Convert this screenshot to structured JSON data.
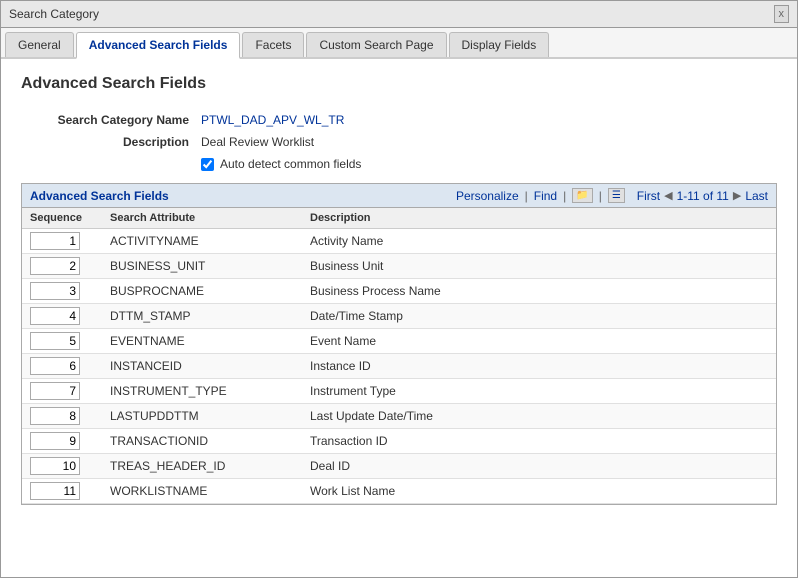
{
  "window": {
    "title": "Search Category",
    "close_label": "x"
  },
  "tabs": [
    {
      "id": "general",
      "label": "General",
      "active": false
    },
    {
      "id": "advanced-search-fields",
      "label": "Advanced Search Fields",
      "active": true
    },
    {
      "id": "facets",
      "label": "Facets",
      "active": false
    },
    {
      "id": "custom-search-page",
      "label": "Custom Search Page",
      "active": false
    },
    {
      "id": "display-fields",
      "label": "Display Fields",
      "active": false
    }
  ],
  "page": {
    "title": "Advanced Search Fields",
    "form": {
      "category_name_label": "Search Category Name",
      "category_name_value": "PTWL_DAD_APV_WL_TR",
      "description_label": "Description",
      "description_value": "Deal Review Worklist",
      "auto_detect_label": "Auto detect common fields"
    },
    "grid": {
      "title": "Advanced Search Fields",
      "controls": {
        "personalize": "Personalize",
        "find": "Find",
        "first": "First",
        "last": "Last",
        "pagination": "1-11 of 11"
      },
      "columns": [
        {
          "id": "sequence",
          "label": "Sequence"
        },
        {
          "id": "search_attribute",
          "label": "Search Attribute"
        },
        {
          "id": "description",
          "label": "Description"
        }
      ],
      "rows": [
        {
          "seq": "1",
          "attr": "ACTIVITYNAME",
          "desc": "Activity Name"
        },
        {
          "seq": "2",
          "attr": "BUSINESS_UNIT",
          "desc": "Business Unit"
        },
        {
          "seq": "3",
          "attr": "BUSPROCNAME",
          "desc": "Business Process Name"
        },
        {
          "seq": "4",
          "attr": "DTTM_STAMP",
          "desc": "Date/Time Stamp"
        },
        {
          "seq": "5",
          "attr": "EVENTNAME",
          "desc": "Event Name"
        },
        {
          "seq": "6",
          "attr": "INSTANCEID",
          "desc": "Instance ID"
        },
        {
          "seq": "7",
          "attr": "INSTRUMENT_TYPE",
          "desc": "Instrument Type"
        },
        {
          "seq": "8",
          "attr": "LASTUPDDTTM",
          "desc": "Last Update Date/Time"
        },
        {
          "seq": "9",
          "attr": "TRANSACTIONID",
          "desc": "Transaction ID"
        },
        {
          "seq": "10",
          "attr": "TREAS_HEADER_ID",
          "desc": "Deal ID"
        },
        {
          "seq": "11",
          "attr": "WORKLISTNAME",
          "desc": "Work List Name"
        }
      ]
    }
  }
}
